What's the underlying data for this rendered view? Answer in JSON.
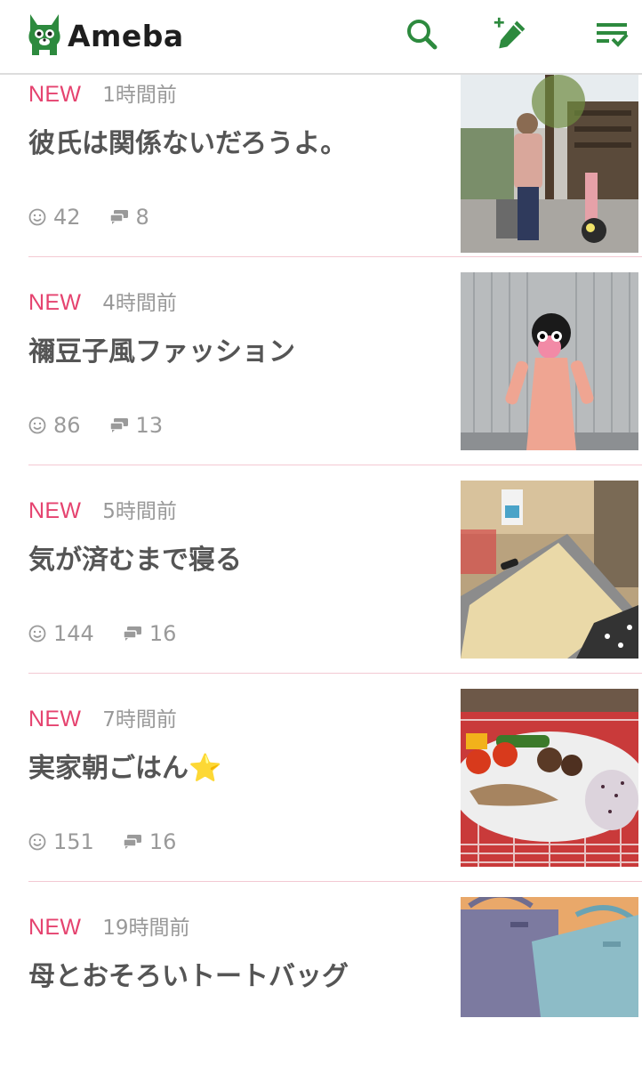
{
  "header": {
    "logo_text": "Ameba",
    "icons": [
      "search-icon",
      "write-post-icon",
      "menu-list-icon"
    ],
    "brand_color": "#2d8a3e"
  },
  "accent_color": "#e5436f",
  "items": [
    {
      "new": "NEW",
      "time": "1時間前",
      "title": "彼氏は関係ないだろうよ。",
      "likes": "42",
      "comments": "8"
    },
    {
      "new": "NEW",
      "time": "4時間前",
      "title": "禰豆子風ファッション",
      "likes": "86",
      "comments": "13"
    },
    {
      "new": "NEW",
      "time": "5時間前",
      "title": "気が済むまで寝る",
      "likes": "144",
      "comments": "16"
    },
    {
      "new": "NEW",
      "time": "7時間前",
      "title": "実家朝ごはん⭐",
      "likes": "151",
      "comments": "16"
    },
    {
      "new": "NEW",
      "time": "19時間前",
      "title": "母とおそろいトートバッグ",
      "likes": "",
      "comments": ""
    }
  ]
}
